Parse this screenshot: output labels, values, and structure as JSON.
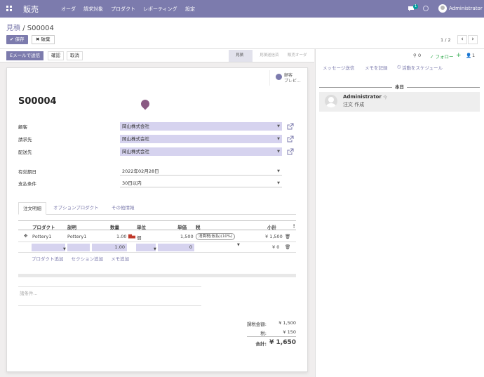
{
  "topbar": {
    "app_name": "販売",
    "menu": [
      "オーダ",
      "請求対象",
      "プロダクト",
      "レポーティング",
      "設定"
    ],
    "chat_badge": "1",
    "user": "Administrator"
  },
  "breadcrumb": {
    "parent": "見積",
    "separator": "/",
    "current": "S00004"
  },
  "buttons": {
    "save": "✔ 保存",
    "discard": "✖ 破棄"
  },
  "pager": {
    "text": "1 / 2",
    "prev": "‹",
    "next": "›"
  },
  "statusbar": {
    "actions": [
      "Eメールで送信",
      "確認",
      "取消"
    ],
    "stages": [
      "見積",
      "見積送信済",
      "販売オーダ"
    ],
    "active_stage": "見積"
  },
  "smart_button": {
    "line1": "顧客",
    "line2": "プレビ..."
  },
  "record": {
    "name": "S00004",
    "fields": [
      {
        "label": "顧客",
        "value": "岡山株式会社"
      },
      {
        "label": "請求先",
        "value": "岡山株式会社"
      },
      {
        "label": "配送先",
        "value": "岡山株式会社"
      }
    ],
    "validity": {
      "label": "有効期日",
      "value": "2022年02月28日"
    },
    "payment_terms": {
      "label": "支払条件",
      "value": "30日以内"
    }
  },
  "tabs": [
    "注文明細",
    "オプションプロダクト",
    "その他情報"
  ],
  "lines": {
    "headers": [
      "プロダクト",
      "説明",
      "数量",
      "単位",
      "単価",
      "税",
      "小計"
    ],
    "rows": [
      {
        "product": "Pottery1",
        "description": "Pottery1",
        "qty": "1.00",
        "uom": "個",
        "price": "1,500",
        "tax": "消費税(仮払)(10%)",
        "subtotal": "¥ 1,500"
      }
    ],
    "edit_row": {
      "qty": "1.00",
      "price": "0",
      "subtotal": "¥ 0"
    },
    "add_links": [
      "プロダクト追加",
      "セクション追加",
      "メモ追加"
    ]
  },
  "terms_placeholder": "諸条件...",
  "totals": [
    {
      "label": "課税金額:",
      "value": "¥ 1,500"
    },
    {
      "label": "税:",
      "value": "¥ 150"
    },
    {
      "label": "合計:",
      "value": "¥ 1,650"
    }
  ],
  "chatter": {
    "attachments": "0",
    "follow": "✓ フォロー",
    "followers": "1",
    "links": [
      "メッセージ送信",
      "メモを記録",
      "活動をスケジュール"
    ],
    "today": "本日",
    "message": {
      "author": "Administrator",
      "time": "- 今",
      "body": "注文 作成"
    }
  },
  "colors": {
    "brand": "#7c7bad",
    "m2o_bg": "#d6d3ef",
    "tax_red": "#c0392b"
  }
}
